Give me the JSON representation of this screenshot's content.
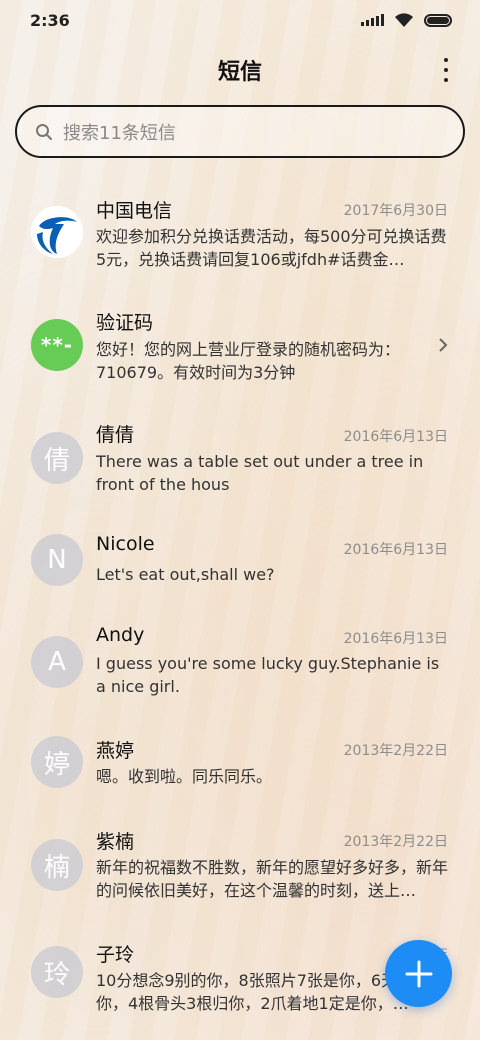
{
  "status_bar": {
    "time": "2:36"
  },
  "header": {
    "title": "短信"
  },
  "search": {
    "placeholder": "搜索11条短信"
  },
  "threads": [
    {
      "name": "中国电信",
      "date": "2017年6月30日",
      "preview": "欢迎参加积分兑换话费活动，每500分可兑换话费5元，兑换话费请回复106或jfdh#话费金…",
      "avatar": "telecom-logo"
    },
    {
      "name": "验证码",
      "date": "",
      "preview": "您好！您的网上营业厅登录的随机密码为：710679。有效时间为3分钟",
      "avatar_text": "**-"
    },
    {
      "name": "倩倩",
      "date": "2016年6月13日",
      "preview": "There was a table set out under a tree in front of the hous",
      "avatar_text": "倩"
    },
    {
      "name": "Nicole",
      "date": "2016年6月13日",
      "preview": "Let's eat out,shall we?",
      "avatar_text": "N"
    },
    {
      "name": "Andy",
      "date": "2016年6月13日",
      "preview": "I guess you're some lucky guy.Stephanie is a nice girl.",
      "avatar_text": "A"
    },
    {
      "name": "燕婷",
      "date": "2013年2月22日",
      "preview": "嗯。收到啦。同乐同乐。",
      "avatar_text": "婷"
    },
    {
      "name": "紫楠",
      "date": "2013年2月22日",
      "preview": "新年的祝福数不胜数，新年的愿望好多好多，新年的问候依旧美好，在这个温馨的时刻，送上…",
      "avatar_text": "楠"
    },
    {
      "name": "子玲",
      "date": "2013年",
      "preview": "10分想念9别的你，8张照片7张是你，6⁠天只像你，4根骨头3根归你，2爪着地1定是你，…",
      "avatar_text": "玲"
    }
  ],
  "colors": {
    "accent": "#1e8cf5",
    "verify_green": "#66cc55"
  }
}
